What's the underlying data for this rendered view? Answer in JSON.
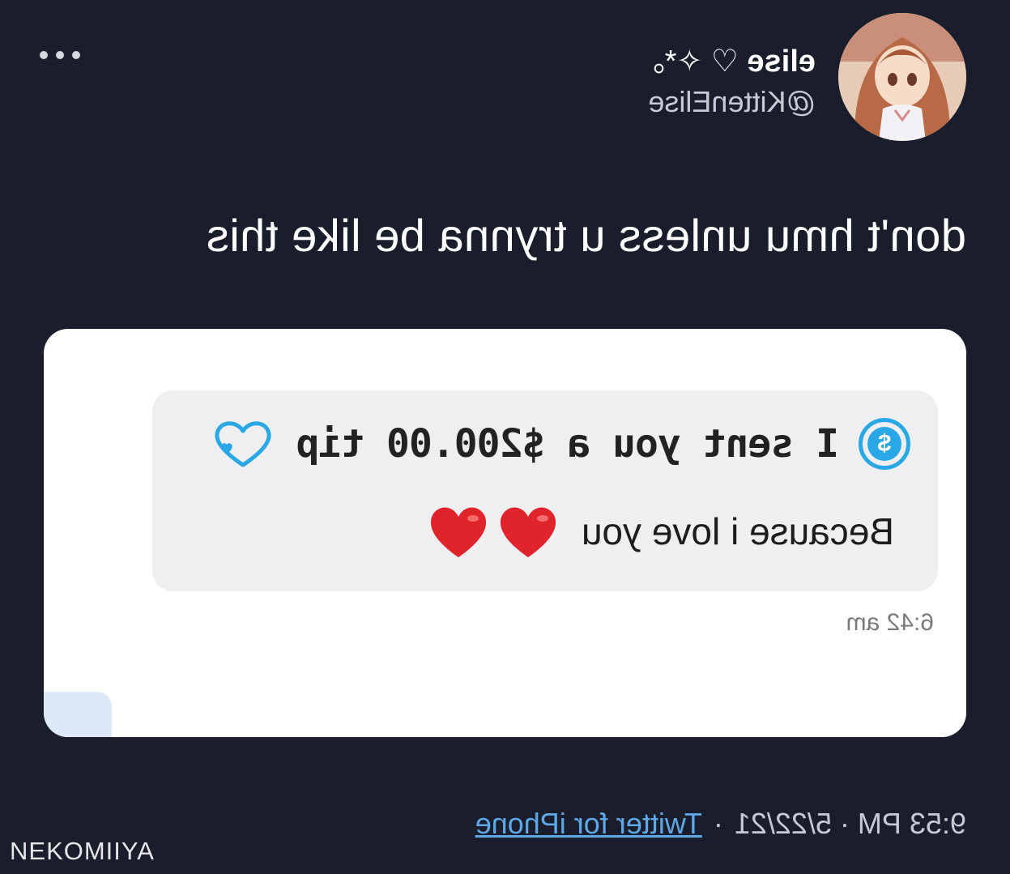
{
  "tweet": {
    "display_name": "elise",
    "name_decoration": " ♡ ✧*｡",
    "handle": "@KittenElise",
    "text": "don't hmu unless u trynna be like this",
    "timestamp": "9:53 PM · 5/22/21",
    "separator": "·",
    "client": "Twitter for iPhone"
  },
  "embedded_screenshot": {
    "tip_message": "I sent you a $200.00 tip",
    "message": "Because i love you",
    "time": "6:42 am",
    "currency_icon": "dollar-circle-icon",
    "reaction_icon": "heart-outline-icon"
  },
  "watermark": "NEKOMIIYA",
  "colors": {
    "background": "#1a1d2b",
    "accent_blue": "#2aa8e6",
    "link_blue": "#5fa8e8",
    "heart_red": "#e0242c"
  },
  "mirrored": true
}
